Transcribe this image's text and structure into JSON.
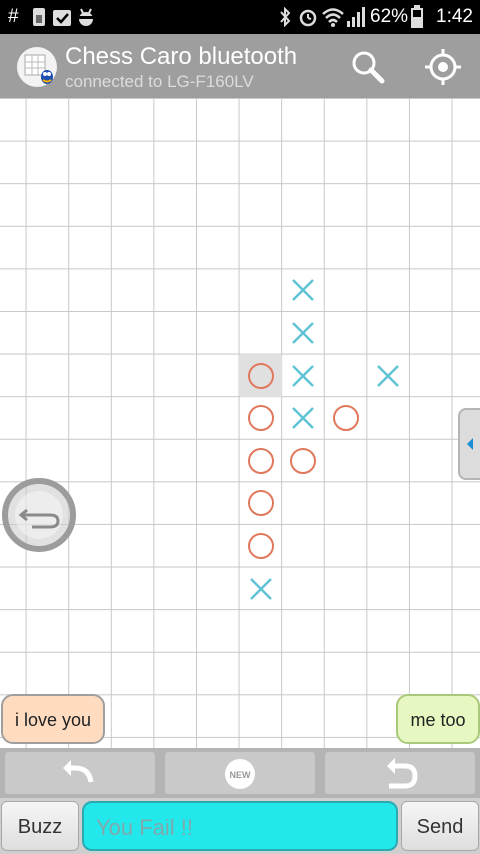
{
  "status_bar": {
    "left_glyph": "#",
    "battery": "62%",
    "time": "1:42"
  },
  "action_bar": {
    "title": "Chess Caro bluetooth",
    "subtitle": "connected to LG-F160LV"
  },
  "board": {
    "x_color": "#5fc3d6",
    "o_color": "#e0785c",
    "highlight": "#e0e0e0",
    "pieces": [
      {
        "col": 7,
        "row": 4,
        "mark": "X"
      },
      {
        "col": 7,
        "row": 5,
        "mark": "X"
      },
      {
        "col": 6,
        "row": 6,
        "mark": "O",
        "last": true
      },
      {
        "col": 7,
        "row": 6,
        "mark": "X"
      },
      {
        "col": 9,
        "row": 6,
        "mark": "X"
      },
      {
        "col": 6,
        "row": 7,
        "mark": "O"
      },
      {
        "col": 7,
        "row": 7,
        "mark": "X"
      },
      {
        "col": 8,
        "row": 7,
        "mark": "O"
      },
      {
        "col": 6,
        "row": 8,
        "mark": "O"
      },
      {
        "col": 7,
        "row": 8,
        "mark": "O"
      },
      {
        "col": 6,
        "row": 9,
        "mark": "O"
      },
      {
        "col": 6,
        "row": 10,
        "mark": "O"
      },
      {
        "col": 6,
        "row": 11,
        "mark": "X"
      }
    ]
  },
  "chat": {
    "left_bubble": "i love you",
    "right_bubble": "me too"
  },
  "toolbar": {
    "new_badge": "NEW"
  },
  "input": {
    "buzz_label": "Buzz",
    "message": "You Fail !!",
    "send_label": "Send"
  }
}
